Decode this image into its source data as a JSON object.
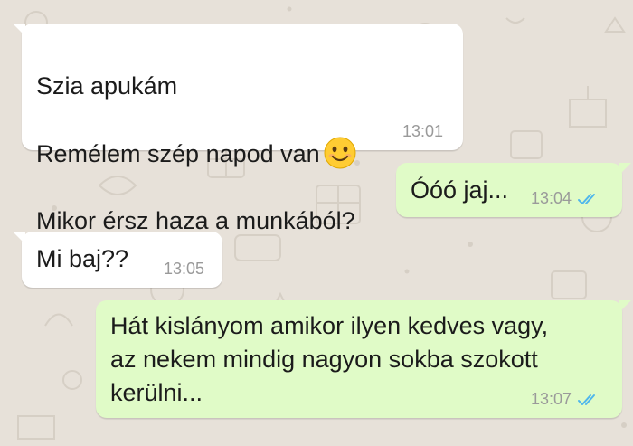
{
  "chat": {
    "background_color": "#e7e1d9",
    "incoming_bubble_color": "#ffffff",
    "outgoing_bubble_color": "#e0fbc7",
    "read_tick_color": "#4fb6ec",
    "messages": [
      {
        "direction": "incoming",
        "lines": [
          "Szia apukám",
          "Remélem szép napod van",
          "Mikor érsz haza a munkából?"
        ],
        "emoji": "smiling-face-emoji",
        "time": "13:01"
      },
      {
        "direction": "outgoing",
        "text": "Óóó jaj...",
        "time": "13:04",
        "status": "read"
      },
      {
        "direction": "incoming",
        "text": "Mi baj??",
        "time": "13:05"
      },
      {
        "direction": "outgoing",
        "text": "Hát kislányom amikor ilyen kedves vagy,\naz nekem mindig nagyon sokba szokott\nkerülni...",
        "time": "13:07",
        "status": "read"
      }
    ]
  }
}
